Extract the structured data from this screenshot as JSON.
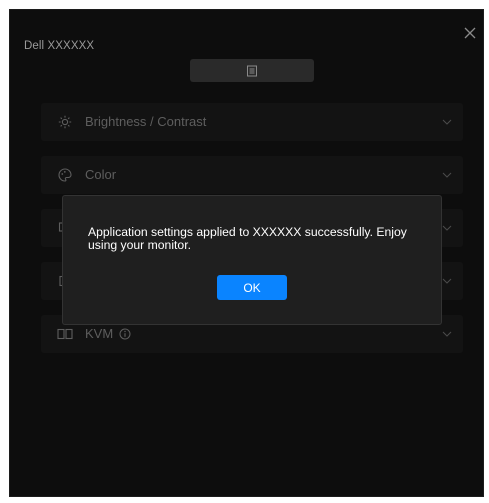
{
  "window": {
    "title": "Dell XXXXXX"
  },
  "sections": [
    {
      "label": "Brightness / Contrast",
      "icon": "brightness-icon"
    },
    {
      "label": "Color",
      "icon": "color-palette-icon"
    },
    {
      "label": "",
      "icon": "input-source-icon"
    },
    {
      "label": "",
      "icon": "display-layout-icon"
    },
    {
      "label": "KVM",
      "icon": "kvm-icon",
      "info_icon": "info-icon"
    }
  ],
  "dialog": {
    "message": "Application settings applied to XXXXXX successfully. Enjoy using your monitor.",
    "ok_label": "OK"
  },
  "colors": {
    "background": "#0d0d0d",
    "section": "#131313",
    "dialog": "#1f1f1f",
    "accent": "#0a84ff"
  }
}
